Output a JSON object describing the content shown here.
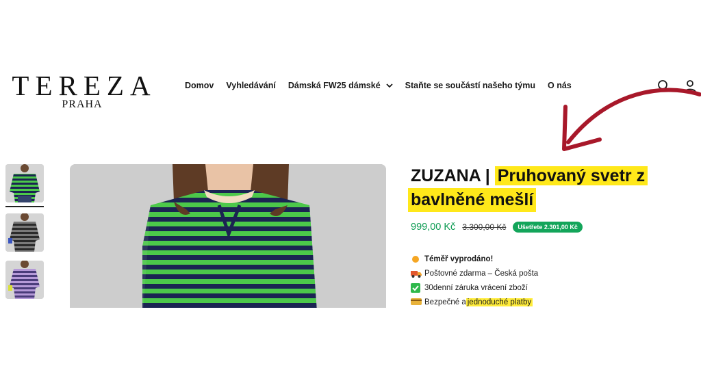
{
  "header": {
    "logo_main": "TEREZA",
    "logo_sub": "PRAHA",
    "nav": [
      {
        "label": "Domov"
      },
      {
        "label": "Vyhledávání"
      },
      {
        "label": "Dámská FW25 dámské"
      },
      {
        "label": "Staňte se součástí našeho týmu"
      },
      {
        "label": "O nás"
      }
    ],
    "icons": [
      "search-icon",
      "user-icon"
    ]
  },
  "gallery": {
    "thumbnails": [
      "green-navy-stripes",
      "grey-stripes",
      "purple-stripes"
    ],
    "active_index": 0
  },
  "product": {
    "title_plain": "ZUZANA |",
    "title_highlight_1": "Pruhovaný svetr z",
    "title_highlight_2": "bavlněné mešlí",
    "price": "999,00 Kč",
    "price_old": "3.300,00 Kč",
    "save_badge": "Ušetřete 2.301,00 Kč",
    "features": [
      {
        "icon": "orange-dot-icon",
        "text": "Téměř vyprodáno!"
      },
      {
        "icon": "truck-icon",
        "text": "Poštovné zdarma – Česká pošta"
      },
      {
        "icon": "checkmark-icon",
        "text": "30denní záruka vrácení zboží"
      },
      {
        "icon": "card-icon",
        "text_plain": "Bezpečné a ",
        "text_highlight": "jednoduché platby"
      }
    ]
  },
  "colors": {
    "highlight": "#ffe81a",
    "price_green": "#0c9b52",
    "badge_green": "#13a55a",
    "arrow_red": "#a8182a",
    "stripe_green": "#4cc84a",
    "stripe_navy": "#1b2452"
  }
}
